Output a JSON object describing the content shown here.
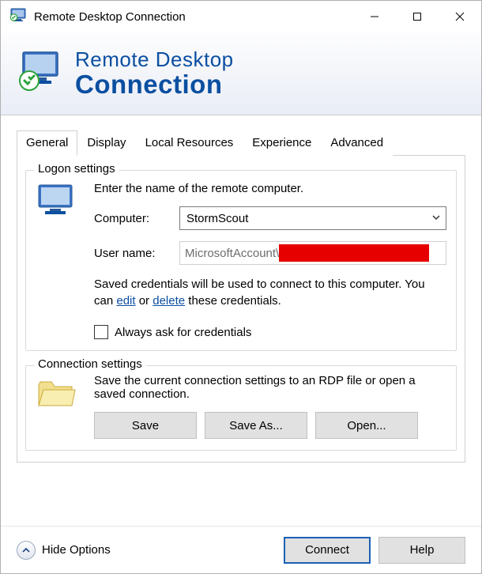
{
  "titlebar": {
    "title": "Remote Desktop Connection"
  },
  "banner": {
    "line1": "Remote Desktop",
    "line2": "Connection"
  },
  "tabs": {
    "general": "General",
    "display": "Display",
    "local_resources": "Local Resources",
    "experience": "Experience",
    "advanced": "Advanced"
  },
  "logon": {
    "legend": "Logon settings",
    "instruction": "Enter the name of the remote computer.",
    "computer_label": "Computer:",
    "computer_value": "StormScout",
    "username_label": "User name:",
    "username_value": "MicrosoftAccount\\",
    "saved_text_1": "Saved credentials will be used to connect to this computer. You can ",
    "saved_link_edit": "edit",
    "saved_text_or": " or ",
    "saved_link_delete": "delete",
    "saved_text_2": " these credentials.",
    "always_ask": "Always ask for credentials"
  },
  "conn": {
    "legend": "Connection settings",
    "instruction": "Save the current connection settings to an RDP file or open a saved connection.",
    "save": "Save",
    "save_as": "Save As...",
    "open": "Open..."
  },
  "footer": {
    "hide_options": "Hide Options",
    "connect": "Connect",
    "help": "Help"
  }
}
